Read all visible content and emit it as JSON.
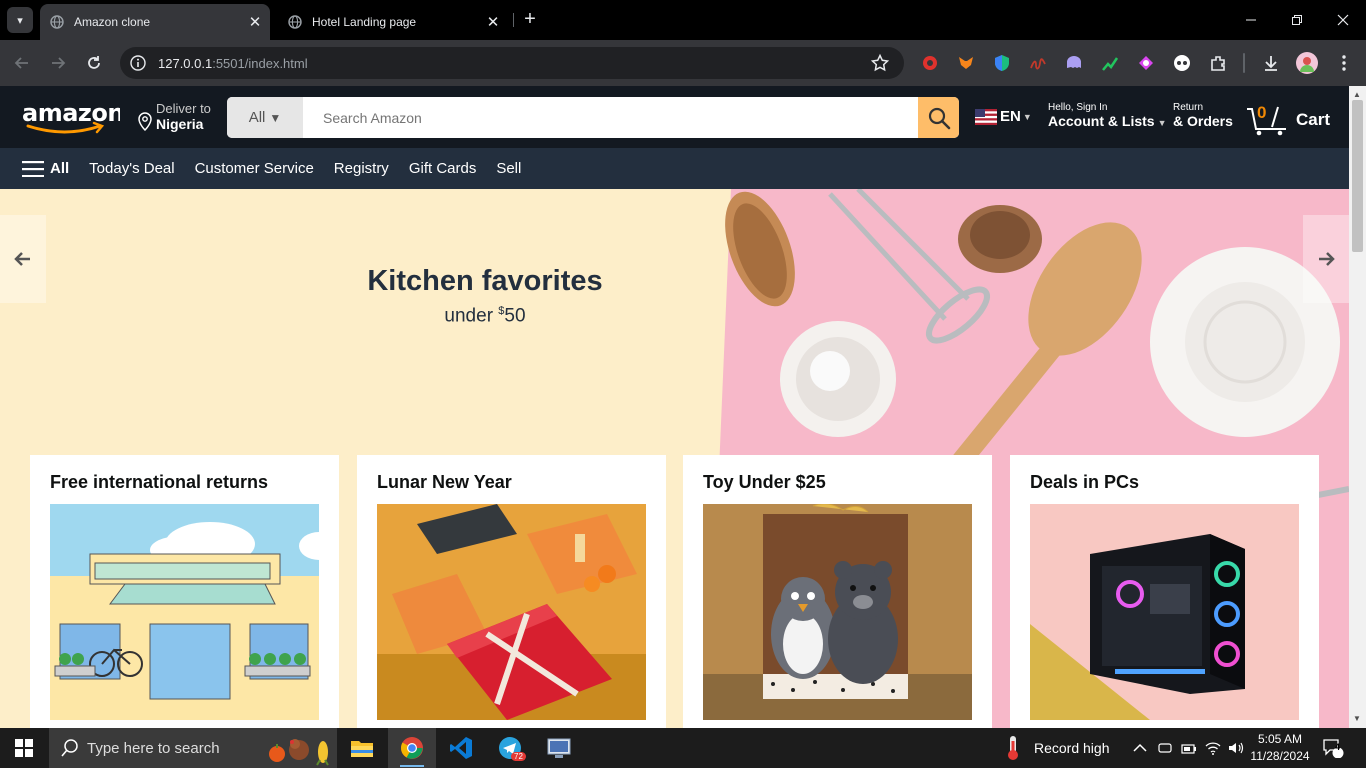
{
  "browser": {
    "tabs": [
      {
        "title": "Amazon clone"
      },
      {
        "title": "Hotel Landing page"
      }
    ],
    "url_host": "127.0.0.1",
    "url_rest": ":5501/index.html",
    "new_tab": "+",
    "tab_close": "✕"
  },
  "header": {
    "deliver_line1": "Deliver to",
    "deliver_line2": "Nigeria",
    "search_category": "All",
    "search_placeholder": "Search Amazon",
    "language": "EN",
    "account_line1": "Hello, Sign In",
    "account_line2": "Account & Lists",
    "returns_line1": "Return",
    "returns_line2": "& Orders",
    "cart_count": "0",
    "cart_label": "Cart"
  },
  "subnav": {
    "all_label": "All",
    "items": [
      "Today's Deal",
      "Customer Service",
      "Registry",
      "Gift Cards",
      "Sell"
    ]
  },
  "hero": {
    "title": "Kitchen favorites",
    "sub_prefix": "under ",
    "sub_currency": "$",
    "sub_amount": "50"
  },
  "cards": [
    {
      "title": "Free international returns"
    },
    {
      "title": "Lunar New Year"
    },
    {
      "title": "Toy Under $25"
    },
    {
      "title": "Deals in PCs"
    }
  ],
  "taskbar": {
    "search_placeholder": "Type here to search",
    "weather_text": "Record high",
    "time": "5:05 AM",
    "date": "11/28/2024",
    "telegram_badge": "72",
    "notification_count": "4"
  },
  "colors": {
    "amazon_nav": "#131921",
    "amazon_subnav": "#232f3e",
    "search_button": "#febd69",
    "hero_bg": "#fdeec9",
    "hero_pink": "#f7b8c9"
  }
}
